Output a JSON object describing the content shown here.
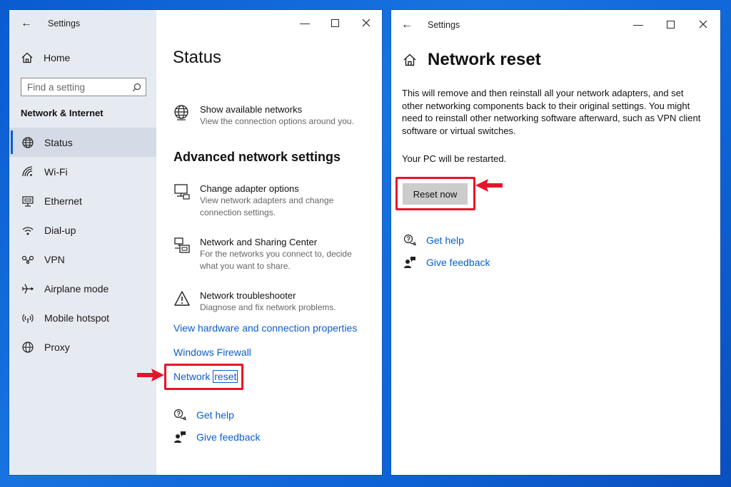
{
  "left_window": {
    "title": "Settings",
    "sidebar": {
      "home_label": "Home",
      "search_placeholder": "Find a setting",
      "section_heading": "Network & Internet",
      "items": [
        {
          "label": "Status",
          "icon": "status-globe-icon"
        },
        {
          "label": "Wi-Fi",
          "icon": "wifi-icon"
        },
        {
          "label": "Ethernet",
          "icon": "ethernet-icon"
        },
        {
          "label": "Dial-up",
          "icon": "dialup-icon"
        },
        {
          "label": "VPN",
          "icon": "vpn-icon"
        },
        {
          "label": "Airplane mode",
          "icon": "airplane-icon"
        },
        {
          "label": "Mobile hotspot",
          "icon": "hotspot-icon"
        },
        {
          "label": "Proxy",
          "icon": "proxy-globe-icon"
        }
      ],
      "active_item": "Status"
    },
    "main": {
      "page_title": "Status",
      "show_networks": {
        "title": "Show available networks",
        "desc": "View the connection options around you."
      },
      "advanced_heading": "Advanced network settings",
      "entries": [
        {
          "title": "Change adapter options",
          "desc1": "View network adapters and change",
          "desc2": "connection settings.",
          "icon": "adapter-monitor-icon"
        },
        {
          "title": "Network and Sharing Center",
          "desc1": "For the networks you connect to, decide",
          "desc2": "what you want to share.",
          "icon": "sharing-center-icon"
        },
        {
          "title": "Network troubleshooter",
          "desc1": "Diagnose and fix network problems.",
          "icon": "warning-triangle-icon"
        }
      ],
      "links": {
        "hardware_props": "View hardware and connection properties",
        "firewall": "Windows Firewall",
        "network_reset_part1": "Network",
        "network_reset_part2": "reset"
      },
      "get_help": "Get help",
      "give_feedback": "Give feedback"
    }
  },
  "right_window": {
    "title": "Settings",
    "page_title": "Network reset",
    "paragraph_lines": [
      "This will remove and then reinstall all your network adapters, and set",
      "other networking components back to their original settings. You might",
      "need to reinstall other networking software afterward, such as VPN client",
      "software or virtual switches."
    ],
    "restart_note": "Your PC will be restarted.",
    "reset_button": "Reset now",
    "get_help": "Get help",
    "give_feedback": "Give feedback"
  },
  "colors": {
    "accent_link": "#0a5ed0",
    "highlight_red": "#e8132a",
    "sidebar_bg": "#e6ebf2",
    "desktop_blue": "#1873e0"
  }
}
